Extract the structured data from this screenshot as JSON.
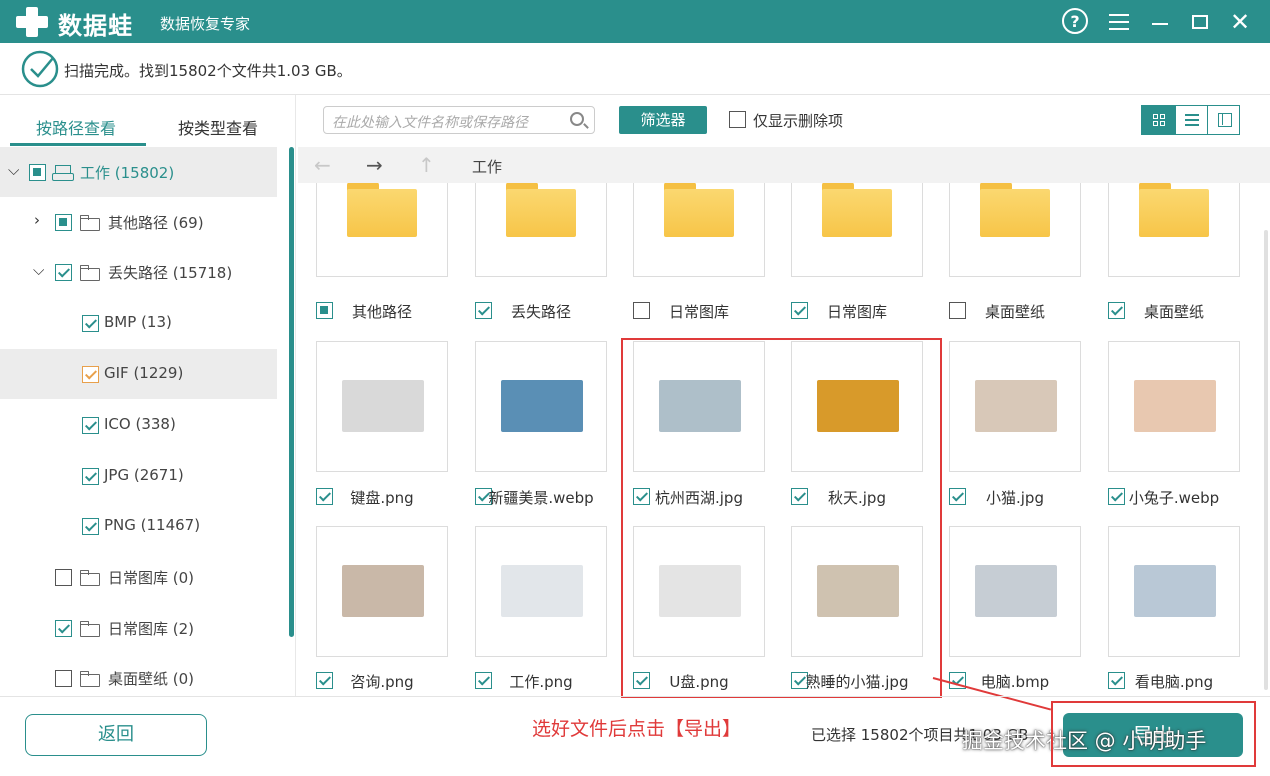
{
  "app": {
    "brand": "数据蛙",
    "subtitle": "数据恢复专家",
    "help": "?"
  },
  "status": {
    "text": "扫描完成。找到15802个文件共1.03 GB。"
  },
  "tabs": {
    "path": "按路径查看",
    "type": "按类型查看"
  },
  "tree": [
    {
      "label": "工作 (15802)",
      "state": "partial"
    },
    {
      "label": "其他路径 (69)",
      "state": "partial"
    },
    {
      "label": "丢失路径 (15718)",
      "state": "checked"
    },
    {
      "label": "BMP (13)",
      "state": "checked"
    },
    {
      "label": "GIF (1229)",
      "state": "checked"
    },
    {
      "label": "ICO (338)",
      "state": "checked"
    },
    {
      "label": "JPG (2671)",
      "state": "checked"
    },
    {
      "label": "PNG (11467)",
      "state": "checked"
    },
    {
      "label": "日常图库 (0)",
      "state": "unchecked"
    },
    {
      "label": "日常图库 (2)",
      "state": "checked"
    },
    {
      "label": "桌面壁纸 (0)",
      "state": "unchecked"
    }
  ],
  "toolbar": {
    "search_placeholder": "在此处输入文件名称或保存路径",
    "filter_label": "筛选器",
    "deleted_only_label": "仅显示删除项"
  },
  "nav": {
    "back": "←",
    "forward": "→",
    "up": "↑",
    "crumb": "工作"
  },
  "files": [
    {
      "name": "其他路径",
      "kind": "folder",
      "state": "partial"
    },
    {
      "name": "丢失路径",
      "kind": "folder",
      "state": "checked"
    },
    {
      "name": "日常图库",
      "kind": "folder",
      "state": "unchecked"
    },
    {
      "name": "日常图库",
      "kind": "folder",
      "state": "checked"
    },
    {
      "name": "桌面壁纸",
      "kind": "folder",
      "state": "unchecked"
    },
    {
      "name": "桌面壁纸",
      "kind": "folder",
      "state": "checked"
    },
    {
      "name": "键盘.png",
      "kind": "image",
      "state": "checked",
      "color": "#d9d9d9"
    },
    {
      "name": "新疆美景.webp",
      "kind": "image",
      "state": "checked",
      "color": "#5a8fb5"
    },
    {
      "name": "杭州西湖.jpg",
      "kind": "image",
      "state": "checked",
      "color": "#aebfc9"
    },
    {
      "name": "秋天.jpg",
      "kind": "image",
      "state": "checked",
      "color": "#d89a2a"
    },
    {
      "name": "小猫.jpg",
      "kind": "image",
      "state": "checked",
      "color": "#d8c8b8"
    },
    {
      "name": "小兔子.webp",
      "kind": "image",
      "state": "checked",
      "color": "#e8c8b0"
    },
    {
      "name": "咨询.png",
      "kind": "image",
      "state": "checked",
      "color": "#c9b8a8"
    },
    {
      "name": "工作.png",
      "kind": "image",
      "state": "checked",
      "color": "#e2e6ea"
    },
    {
      "name": "U盘.png",
      "kind": "image",
      "state": "checked",
      "color": "#e4e4e4"
    },
    {
      "name": "熟睡的小猫.jpg",
      "kind": "image",
      "state": "checked",
      "color": "#cfc2b0"
    },
    {
      "name": "电脑.bmp",
      "kind": "image",
      "state": "checked",
      "color": "#c6cdd4"
    },
    {
      "name": "看电脑.png",
      "kind": "image",
      "state": "checked",
      "color": "#b9c8d6"
    }
  ],
  "footer": {
    "back_label": "返回",
    "annotation": "选好文件后点击【导出】",
    "selected_text": "已选择 15802个项目共1.03 GB",
    "export_label": "导出",
    "watermark": "掘金技术社区 @ 小明助手"
  },
  "colors": {
    "accent": "#2a8f8c",
    "highlight": "#e03a3a"
  }
}
